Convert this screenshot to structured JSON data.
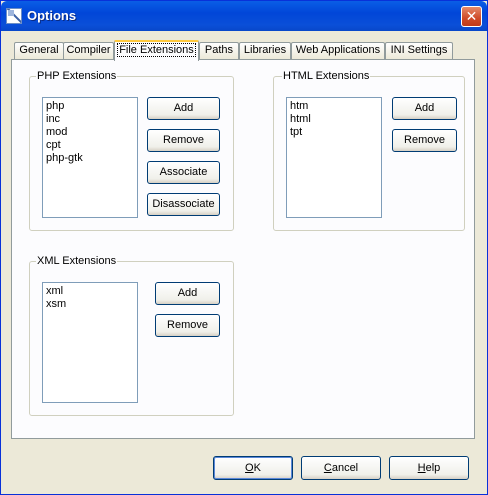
{
  "window": {
    "title": "Options",
    "close_glyph": "✕"
  },
  "tabs": [
    {
      "label": "General"
    },
    {
      "label": "Compiler"
    },
    {
      "label": "File Extensions",
      "active": true
    },
    {
      "label": "Paths"
    },
    {
      "label": "Libraries"
    },
    {
      "label": "Web Applications"
    },
    {
      "label": "INI Settings"
    }
  ],
  "php": {
    "label": "PHP Extensions",
    "items": [
      "php",
      "inc",
      "mod",
      "cpt",
      "php-gtk"
    ],
    "add": "Add",
    "remove": "Remove",
    "associate": "Associate",
    "disassociate": "Disassociate"
  },
  "html": {
    "label": "HTML Extensions",
    "items": [
      "htm",
      "html",
      "tpt"
    ],
    "add": "Add",
    "remove": "Remove"
  },
  "xml": {
    "label": "XML Extensions",
    "items": [
      "xml",
      "xsm"
    ],
    "add": "Add",
    "remove": "Remove"
  },
  "footer": {
    "ok_first": "O",
    "ok_rest": "K",
    "cancel_first": "C",
    "cancel_rest": "ancel",
    "help_first": "H",
    "help_rest": "elp"
  },
  "icons": {
    "app": "options-app-icon",
    "close": "close-icon"
  }
}
